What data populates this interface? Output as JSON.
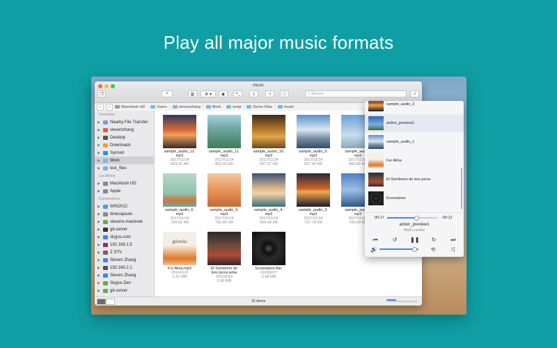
{
  "headline": "Play all major music formats",
  "window": {
    "title": "music",
    "search_placeholder": "Search",
    "path": [
      "Macintosh HD",
      "Users",
      "stevenzhang",
      "Work",
      "temp",
      "Demo Files",
      "music"
    ],
    "status": "15 items"
  },
  "sidebar": {
    "favorites_head": "Favorites",
    "favorites": [
      {
        "label": "Nearby File Transfer",
        "icon": "airdrop-icon",
        "color": "#6fa3e0"
      },
      {
        "label": "stevenzhang",
        "icon": "home-icon",
        "color": "#e7583c"
      },
      {
        "label": "Desktop",
        "icon": "desktop-icon",
        "color": "#555555"
      },
      {
        "label": "Downloads",
        "icon": "downloads-icon",
        "color": "#f4a11b"
      },
      {
        "label": "Synced",
        "icon": "sync-icon",
        "color": "#1a9ae0"
      },
      {
        "label": "Work",
        "icon": "folder-icon",
        "color": "#7cb8e6"
      },
      {
        "label": "test_files",
        "icon": "folder-icon",
        "color": "#7cb8e6"
      }
    ],
    "locations_head": "Locations",
    "locations": [
      {
        "label": "Macintosh HD",
        "icon": "disk-icon",
        "color": "#888888"
      },
      {
        "label": "Apple",
        "icon": "disk-icon",
        "color": "#888888"
      }
    ],
    "connections_head": "Connections",
    "connections": [
      {
        "label": "WIN2012",
        "icon": "windows-icon",
        "color": "#45a0e6"
      },
      {
        "label": "timecapsule",
        "icon": "timecapsule-icon",
        "color": "#888888"
      },
      {
        "label": "stevens-macbook",
        "icon": "server-icon",
        "color": "#6aa84f"
      },
      {
        "label": "git-server",
        "icon": "linux-icon",
        "color": "#333333"
      },
      {
        "label": "skyjos.com",
        "icon": "globe-icon",
        "color": "#3d86f0"
      },
      {
        "label": "192.168.1.5",
        "icon": "dlna-icon",
        "color": "#9c2b6b"
      },
      {
        "label": "Z STV",
        "icon": "tv-icon",
        "color": "#666666"
      },
      {
        "label": "Steven Zhang",
        "icon": "dropbox-icon",
        "color": "#3d86f0"
      },
      {
        "label": "192.168.2.1",
        "icon": "globe-icon",
        "color": "#555555"
      },
      {
        "label": "Steven Zhang",
        "icon": "cloud-icon",
        "color": "#3d86f0"
      },
      {
        "label": "Skyjos Dev",
        "icon": "server-icon",
        "color": "#6aa84f"
      },
      {
        "label": "git-server",
        "icon": "server-icon",
        "color": "#6aa84f"
      }
    ]
  },
  "files": [
    {
      "name": "sample_audio_12.",
      "name2": "mp3",
      "date": "2017/11/14",
      "size": "823.31 KB",
      "art": "sunset-boat"
    },
    {
      "name": "sample_audio_11.",
      "name2": "mp3",
      "date": "2017/11/14",
      "size": "852.43 KB",
      "art": "river"
    },
    {
      "name": "sample_audio_10.",
      "name2": "mp3",
      "date": "2017/11/14",
      "size": "837.37 KB",
      "art": "dunes"
    },
    {
      "name": "sample_audio_9.",
      "name2": "mp3",
      "date": "2017/11/14",
      "size": "837.99 KB",
      "art": "mountains"
    },
    {
      "name": "sample_audio_",
      "name2": "mp3",
      "date": "2017/11/14",
      "size": "865.65 KB",
      "art": "clouds"
    },
    {
      "name": "sample_audio_6.",
      "name2": "mp3",
      "date": "2017/11/14",
      "size": "799.52 KB",
      "art": "boat"
    },
    {
      "name": "sample_audio_5.",
      "name2": "mp3",
      "date": "2017/11/14",
      "size": "791.66 KB",
      "art": "desert"
    },
    {
      "name": "sample_audio_4.",
      "name2": "mp3",
      "date": "2017/11/14",
      "size": "904.34 KB",
      "art": "beach"
    },
    {
      "name": "sample_audio_3.",
      "name2": "mp3",
      "date": "2017/11/14",
      "size": "797.78 KB",
      "art": "sea-sunset"
    },
    {
      "name": "sample_audio_",
      "name2": "mp3",
      "date": "2017/11/14",
      "size": "789.00 KB",
      "art": "lake"
    },
    {
      "name": "Fur Alina.mp3",
      "name2": "",
      "date": "2014/11/3",
      "size": "5.37 MB",
      "art": "gorecki"
    },
    {
      "name": "El Sombrero de",
      "name2": "tres picos.wma",
      "date": "2015/5/19",
      "size": "5.90 MB",
      "art": "sombrero"
    },
    {
      "name": "Ecossaises.flac",
      "name2": "",
      "date": "2018/6/27",
      "size": "2.94 MB",
      "art": "vinyl"
    }
  ],
  "gorecki_label": "górecki",
  "player": {
    "playlist": [
      {
        "title": "sample_audio_3",
        "art": "sea-sunset"
      },
      {
        "title": "action_preview1",
        "art": "sky"
      },
      {
        "title": "sample_audio_1",
        "art": "mountains"
      },
      {
        "title": "Fur Alina",
        "art": "gorecki"
      },
      {
        "title": "El Sombrero de tres picos",
        "art": "sombrero"
      },
      {
        "title": "Ecossaises",
        "art": "vinyl"
      }
    ],
    "elapsed": "00:17",
    "remaining": "-00:12",
    "progress": 0.58,
    "volume": 0.9,
    "now_title": "action_preview1",
    "now_artist": "Matt Luedke"
  }
}
